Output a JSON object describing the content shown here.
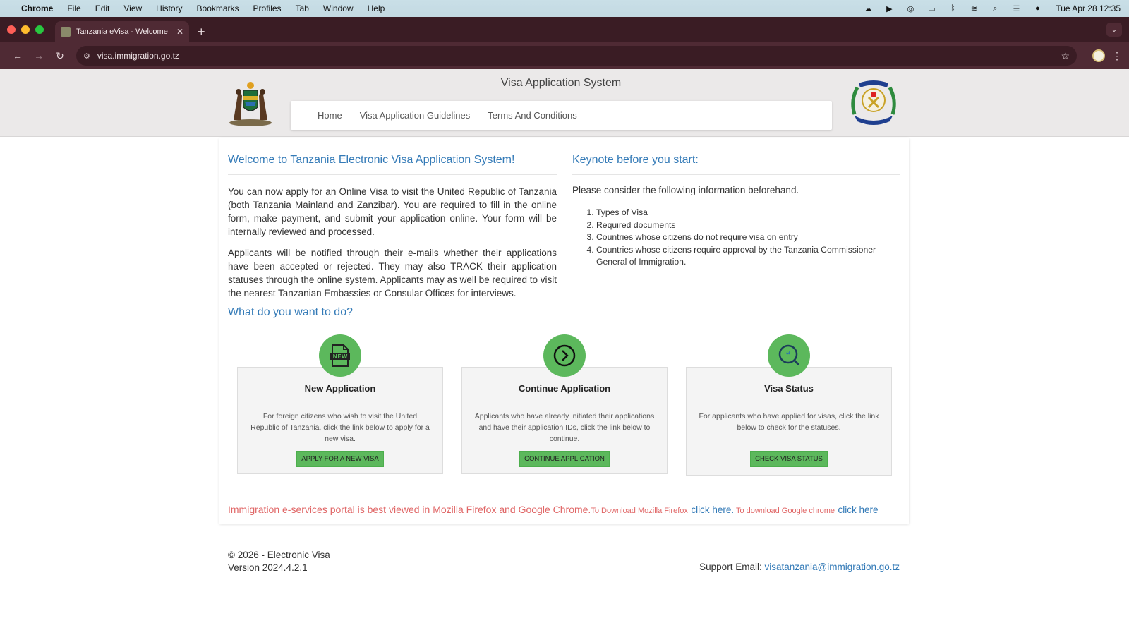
{
  "menubar": {
    "app": "Chrome",
    "items": [
      "File",
      "Edit",
      "View",
      "History",
      "Bookmarks",
      "Profiles",
      "Tab",
      "Window",
      "Help"
    ],
    "clock": "Tue Apr 28  12:35"
  },
  "browser": {
    "tab_title": "Tanzania eVisa - Welcome",
    "url": "visa.immigration.go.tz"
  },
  "header": {
    "title": "Visa Application System",
    "nav": [
      "Home",
      "Visa Application Guidelines",
      "Terms And Conditions"
    ]
  },
  "welcome": {
    "heading": "Welcome to Tanzania Electronic Visa Application System!",
    "para1": "You can now apply for an Online Visa to visit the United Republic of Tanzania (both Tanzania Mainland and Zanzibar). You are required to fill in the online form, make payment, and submit your application online. Your form will be internally reviewed and processed.",
    "para2": "Applicants will be notified through their e-mails whether their applications have been accepted or rejected. They may also TRACK their application statuses through the online system. Applicants may as well be required to visit the nearest Tanzanian Embassies or Consular Offices for interviews."
  },
  "keynote": {
    "heading": "Keynote before you start:",
    "intro": "Please consider the following information beforehand.",
    "items": [
      "Types of Visa",
      "Required documents",
      "Countries whose citizens do not require visa on entry",
      "Countries whose citizens require approval by the Tanzania Commissioner General of Immigration."
    ]
  },
  "actions": {
    "heading": "What do you want to do?",
    "cards": [
      {
        "title": "New Application",
        "desc": "For foreign citizens who wish to visit the United Republic of Tanzania, click the link below to apply for a new visa.",
        "button": "APPLY FOR A NEW VISA",
        "icon": "new-document-icon"
      },
      {
        "title": "Continue Application",
        "desc": "Applicants who have already initiated their applications and have their application IDs, click the link below to continue.",
        "button": "CONTINUE APPLICATION",
        "icon": "arrow-circle-right-icon"
      },
      {
        "title": "Visa Status",
        "desc": "For applicants who have applied for visas, click the link below to check for the statuses.",
        "button": "CHECK VISA STATUS",
        "icon": "search-chat-icon"
      }
    ]
  },
  "notice": {
    "main": "Immigration e-services portal is best viewed in Mozilla Firefox and Google Chrome.",
    "firefox_pre": "To Download Mozilla Firefox",
    "firefox_link": "click here.",
    "chrome_pre": " To download Google chrome",
    "chrome_link": "click here"
  },
  "footer": {
    "copyright": "© 2026 - Electronic Visa",
    "version": "Version 2024.4.2.1",
    "support_label": "Support Email: ",
    "support_email": "visatanzania@immigration.go.tz"
  },
  "colors": {
    "accent_green": "#5cb85c",
    "link_blue": "#337ab7",
    "notice_red": "#e06666",
    "browser_frame": "#4f2a34"
  }
}
